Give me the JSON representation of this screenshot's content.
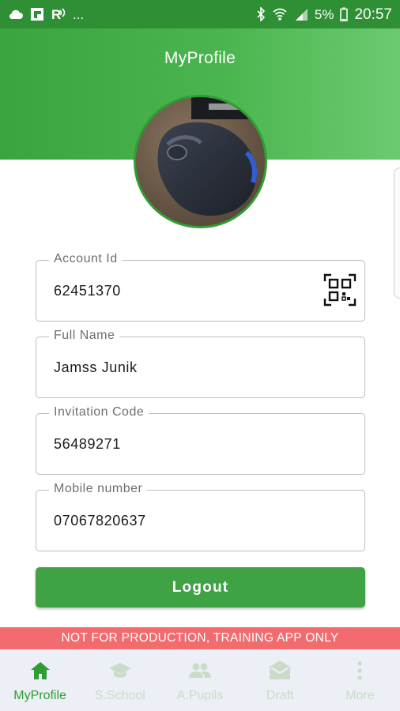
{
  "status_bar": {
    "left_text": "...",
    "time": "20:57",
    "battery": "5%",
    "left_icons": [
      "cloud-icon",
      "flipboard-icon",
      "signal-r-icon"
    ],
    "right_icons": [
      "bluetooth-icon",
      "wifi-icon",
      "cell-signal-icon",
      "battery-icon"
    ]
  },
  "header": {
    "title": "MyProfile"
  },
  "avatar": {
    "icon": "avatar-photo-mouse"
  },
  "fields": [
    {
      "label": "Account Id",
      "value": "62451370",
      "has_qr": true
    },
    {
      "label": "Full Name",
      "value": "Jamss Junik"
    },
    {
      "label": "Invitation Code",
      "value": "56489271"
    },
    {
      "label": "Mobile number",
      "value": "07067820637"
    }
  ],
  "logout_label": "Logout",
  "banner_text": "NOT FOR PRODUCTION, TRAINING APP ONLY",
  "nav": [
    {
      "label": "MyProfile",
      "icon": "home-icon",
      "active": true
    },
    {
      "label": "S.School",
      "icon": "graduation-cap-icon",
      "active": false
    },
    {
      "label": "A.Pupils",
      "icon": "people-icon",
      "active": false
    },
    {
      "label": "Draft",
      "icon": "drafts-mail-icon",
      "active": false
    },
    {
      "label": "More",
      "icon": "more-vertical-icon",
      "active": false
    }
  ],
  "colors": {
    "primary": "#3fa244",
    "status_bar": "#2f8f35",
    "banner": "#f26b6f",
    "nav_background": "#eceff5",
    "nav_inactive": "#c9dcc9"
  }
}
